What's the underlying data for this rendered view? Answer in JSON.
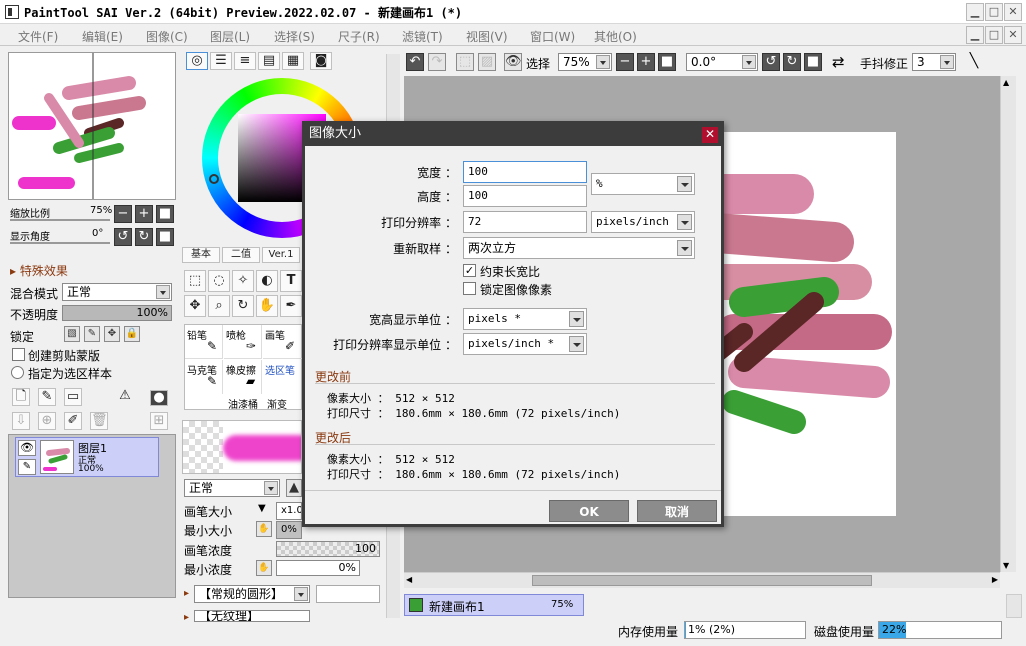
{
  "window": {
    "title": "PaintTool SAI Ver.2 (64bit) Preview.2022.02.07 - 新建画布1 (*)",
    "min": "▁",
    "max": "□",
    "close": "✕"
  },
  "menu": [
    "文件(F)",
    "编辑(E)",
    "图像(C)",
    "图层(L)",
    "选择(S)",
    "尺子(R)",
    "滤镜(T)",
    "视图(V)",
    "窗口(W)",
    "其他(O)"
  ],
  "navigator": {
    "zoom_label": "缩放比例",
    "zoom_value": "75%",
    "angle_label": "显示角度",
    "angle_value": "0°"
  },
  "layer_panel": {
    "effects_label": "特殊效果",
    "blend_label": "混合模式",
    "blend_value": "正常",
    "opacity_label": "不透明度",
    "opacity_value": "100%",
    "lock_label": "锁定",
    "clip_label": "创建剪贴蒙版",
    "sample_label": "指定为选区样本",
    "layer": {
      "name": "图层1",
      "mode": "正常",
      "opacity": "100%"
    }
  },
  "color_panel": {
    "tabs": [
      "基本",
      "二值",
      "Ver.1"
    ]
  },
  "brush_tools": [
    "铅笔",
    "喷枪",
    "画笔",
    "马克笔",
    "橡皮擦",
    "选区笔",
    "油漆桶",
    "渐变"
  ],
  "brush_settings": {
    "mode_value": "正常",
    "size_label": "画笔大小",
    "size_mult": "x1.0",
    "min_size_label": "最小大小",
    "min_size_value": "0%",
    "density_label": "画笔浓度",
    "density_value": "100",
    "min_density_label": "最小浓度",
    "min_density_value": "0%",
    "shape_value": "【常规的圆形】",
    "texture_value": "【无纹理】"
  },
  "canvas_toolbar": {
    "select_label": "选择",
    "zoom_value": "75%",
    "angle_value": "0.0°",
    "stabilizer_label": "手抖修正",
    "stabilizer_value": "3"
  },
  "canvas_tab": {
    "name": "新建画布1",
    "zoom": "75%"
  },
  "status": {
    "memory_label": "内存使用量",
    "memory_value": "1% (2%)",
    "memory_fraction": 0.01,
    "disk_label": "磁盘使用量",
    "disk_value": "22%",
    "disk_fraction": 0.22
  },
  "dialog": {
    "title": "图像大小",
    "width_label": "宽度 ：",
    "width_value": "100",
    "height_label": "高度 ：",
    "height_value": "100",
    "unit_value": "%",
    "resolution_label": "打印分辨率 ：",
    "resolution_value": "72",
    "resolution_unit": "pixels/inch",
    "resample_label": "重新取样 ：",
    "resample_value": "两次立方",
    "constrain_label": "约束长宽比",
    "constrain_checked": "✓",
    "lock_pixels_label": "锁定图像像素",
    "display_unit_label": "宽高显示单位 ：",
    "display_unit_value": "pixels *",
    "print_unit_label": "打印分辨率显示单位 ：",
    "print_unit_value": "pixels/inch *",
    "before_label": "更改前",
    "before_pixel": "像素大小 ： 512 × 512",
    "before_print": "打印尺寸 ： 180.6mm × 180.6mm (72 pixels/inch)",
    "after_label": "更改后",
    "after_pixel": "像素大小 ： 512 × 512",
    "after_print": "打印尺寸 ： 180.6mm × 180.6mm (72 pixels/inch)",
    "ok_label": "OK",
    "cancel_label": "取消"
  }
}
